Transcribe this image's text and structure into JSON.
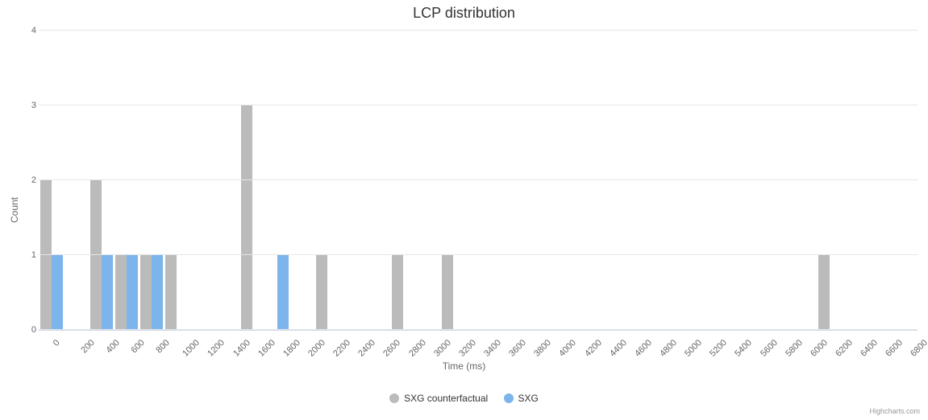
{
  "chart_data": {
    "type": "bar",
    "title": "LCP distribution",
    "xlabel": "Time (ms)",
    "ylabel": "Count",
    "ylim": [
      0,
      4
    ],
    "yticks": [
      0,
      1,
      2,
      3,
      4
    ],
    "categories": [
      "0",
      "200",
      "400",
      "600",
      "800",
      "1000",
      "1200",
      "1400",
      "1600",
      "1800",
      "2000",
      "2200",
      "2400",
      "2600",
      "2800",
      "3000",
      "3200",
      "3400",
      "3600",
      "3800",
      "4000",
      "4200",
      "4400",
      "4600",
      "4800",
      "5000",
      "5200",
      "5400",
      "5600",
      "5800",
      "6000",
      "6200",
      "6400",
      "6600",
      "6800"
    ],
    "series": [
      {
        "name": "SXG counterfactual",
        "color": "#bbbbbb",
        "values": [
          2,
          0,
          2,
          1,
          1,
          1,
          0,
          0,
          3,
          0,
          0,
          1,
          0,
          0,
          1,
          0,
          1,
          0,
          0,
          0,
          0,
          0,
          0,
          0,
          0,
          0,
          0,
          0,
          0,
          0,
          0,
          1,
          0,
          0,
          0
        ]
      },
      {
        "name": "SXG",
        "color": "#7cb5ec",
        "values": [
          1,
          0,
          1,
          1,
          1,
          0,
          0,
          0,
          0,
          1,
          0,
          0,
          0,
          0,
          0,
          0,
          0,
          0,
          0,
          0,
          0,
          0,
          0,
          0,
          0,
          0,
          0,
          0,
          0,
          0,
          0,
          0,
          0,
          0,
          0
        ]
      }
    ],
    "credits": "Highcharts.com"
  }
}
